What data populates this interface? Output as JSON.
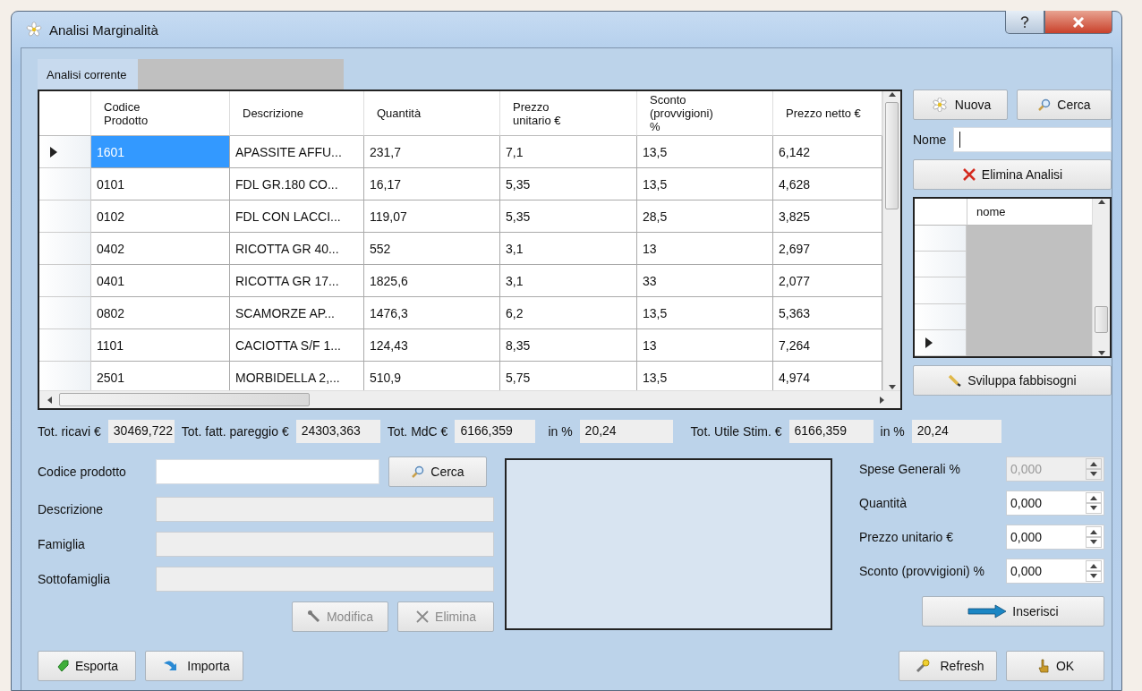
{
  "window": {
    "title": "Analisi Marginalità"
  },
  "current_analysis": {
    "label": "Analisi corrente"
  },
  "table": {
    "columns": [
      "Codice Prodotto",
      "Descrizione",
      "Quantità",
      "Prezzo unitario €",
      "Sconto (provvigioni) %",
      "Prezzo netto €"
    ],
    "rows": [
      {
        "selected": true,
        "cells": [
          "1601",
          "APASSITE AFFU...",
          "231,7",
          "7,1",
          "13,5",
          "6,142"
        ]
      },
      {
        "selected": false,
        "cells": [
          "0101",
          "FDL GR.180 CO...",
          "16,17",
          "5,35",
          "13,5",
          "4,628"
        ]
      },
      {
        "selected": false,
        "cells": [
          "0102",
          "FDL CON LACCI...",
          "119,07",
          "5,35",
          "28,5",
          "3,825"
        ]
      },
      {
        "selected": false,
        "cells": [
          "0402",
          "RICOTTA GR 40...",
          "552",
          "3,1",
          "13",
          "2,697"
        ]
      },
      {
        "selected": false,
        "cells": [
          "0401",
          "RICOTTA GR 17...",
          "1825,6",
          "3,1",
          "33",
          "2,077"
        ]
      },
      {
        "selected": false,
        "cells": [
          "0802",
          "SCAMORZE AP...",
          "1476,3",
          "6,2",
          "13,5",
          "5,363"
        ]
      },
      {
        "selected": false,
        "cells": [
          "1101",
          "CACIOTTA S/F 1...",
          "124,43",
          "8,35",
          "13",
          "7,264"
        ]
      },
      {
        "selected": false,
        "cells": [
          "2501",
          "MORBIDELLA 2,...",
          "510,9",
          "5,75",
          "13,5",
          "4,974"
        ]
      }
    ]
  },
  "side_panel": {
    "new_button": "Nuova",
    "search_button": "Cerca",
    "name_label": "Nome",
    "delete_button": "Elimina Analisi",
    "names_grid": {
      "column": "nome",
      "rows": [
        {
          "selected": false
        },
        {
          "selected": false
        },
        {
          "selected": false
        },
        {
          "selected": false
        },
        {
          "selected": true
        }
      ]
    },
    "develop_button": "Sviluppa fabbisogni"
  },
  "totals": [
    {
      "label": "Tot. ricavi €",
      "value": "30469,722"
    },
    {
      "label": "Tot. fatt. pareggio €",
      "value": "24303,363"
    },
    {
      "label": "Tot. MdC €",
      "value": "6166,359"
    },
    {
      "label": "in %",
      "value": "20,24"
    },
    {
      "label": "Tot. Utile Stim. €",
      "value": "6166,359"
    },
    {
      "label": "in %",
      "value": "20,24"
    }
  ],
  "product_form": {
    "fields": [
      {
        "label": "Codice prodotto",
        "disabled": false
      },
      {
        "label": "Descrizione",
        "disabled": true
      },
      {
        "label": "Famiglia",
        "disabled": true
      },
      {
        "label": "Sottofamiglia",
        "disabled": true
      }
    ],
    "search_button": "Cerca",
    "actions": [
      {
        "label": "Modifica",
        "kind": "edit",
        "disabled": true
      },
      {
        "label": "Elimina",
        "kind": "delete",
        "disabled": true
      }
    ]
  },
  "spinners": [
    {
      "label": "Spese Generali %",
      "value": "0,000",
      "disabled": true
    },
    {
      "label": "Quantità",
      "value": "0,000",
      "disabled": false
    },
    {
      "label": "Prezzo unitario €",
      "value": "0,000",
      "disabled": false
    },
    {
      "label": "Sconto (provvigioni) %",
      "value": "0,000",
      "disabled": false
    }
  ],
  "insert_button": "Inserisci",
  "bottom_left_buttons": [
    {
      "label": "Esporta",
      "kind": "export"
    },
    {
      "label": "Importa",
      "kind": "import"
    }
  ],
  "bottom_right_buttons": [
    {
      "label": "Refresh",
      "kind": "refresh"
    },
    {
      "label": "OK",
      "kind": "ok"
    }
  ]
}
